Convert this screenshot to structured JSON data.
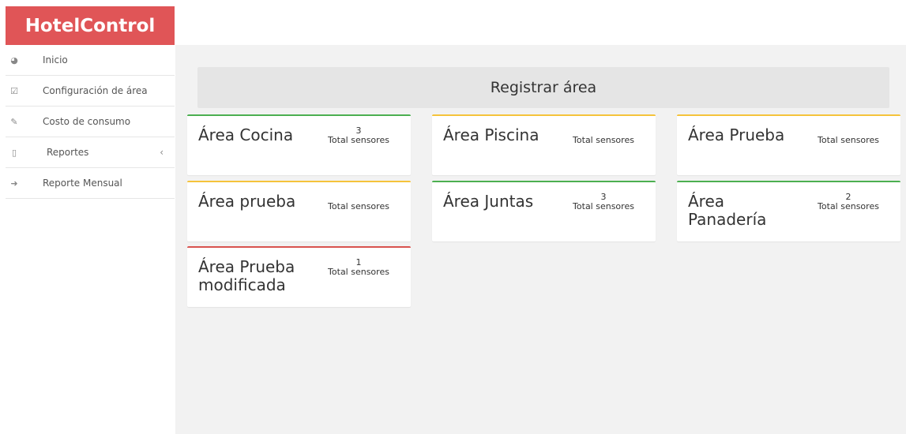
{
  "brand": {
    "name": "HotelControl"
  },
  "sidebar": {
    "items": [
      {
        "label": "Inicio",
        "icon": "dashboard-icon"
      },
      {
        "label": "Configuración de área",
        "icon": "check-square-icon"
      },
      {
        "label": "Costo de consumo",
        "icon": "pencil-icon"
      },
      {
        "label": "Reportes",
        "icon": "file-icon",
        "chevron": "‹"
      },
      {
        "label": "Reporte Mensual",
        "icon": "arrow-right-icon"
      }
    ]
  },
  "main": {
    "register_label": "Registrar área",
    "sensor_label": "Total sensores",
    "cards": [
      {
        "title": "Área Cocina",
        "count": "3",
        "status_color": "#4caf50"
      },
      {
        "title": "Área Piscina",
        "count": "",
        "status_color": "#f5c33b"
      },
      {
        "title": "Área Prueba",
        "count": "",
        "status_color": "#f5c33b"
      },
      {
        "title": "Área prueba",
        "count": "",
        "status_color": "#f5c33b"
      },
      {
        "title": "Área Juntas",
        "count": "3",
        "status_color": "#4caf50"
      },
      {
        "title": "Área Panadería",
        "count": "2",
        "status_color": "#4caf50"
      },
      {
        "title": "Área Prueba modificada",
        "count": "1",
        "status_color": "#d9534f"
      }
    ]
  }
}
